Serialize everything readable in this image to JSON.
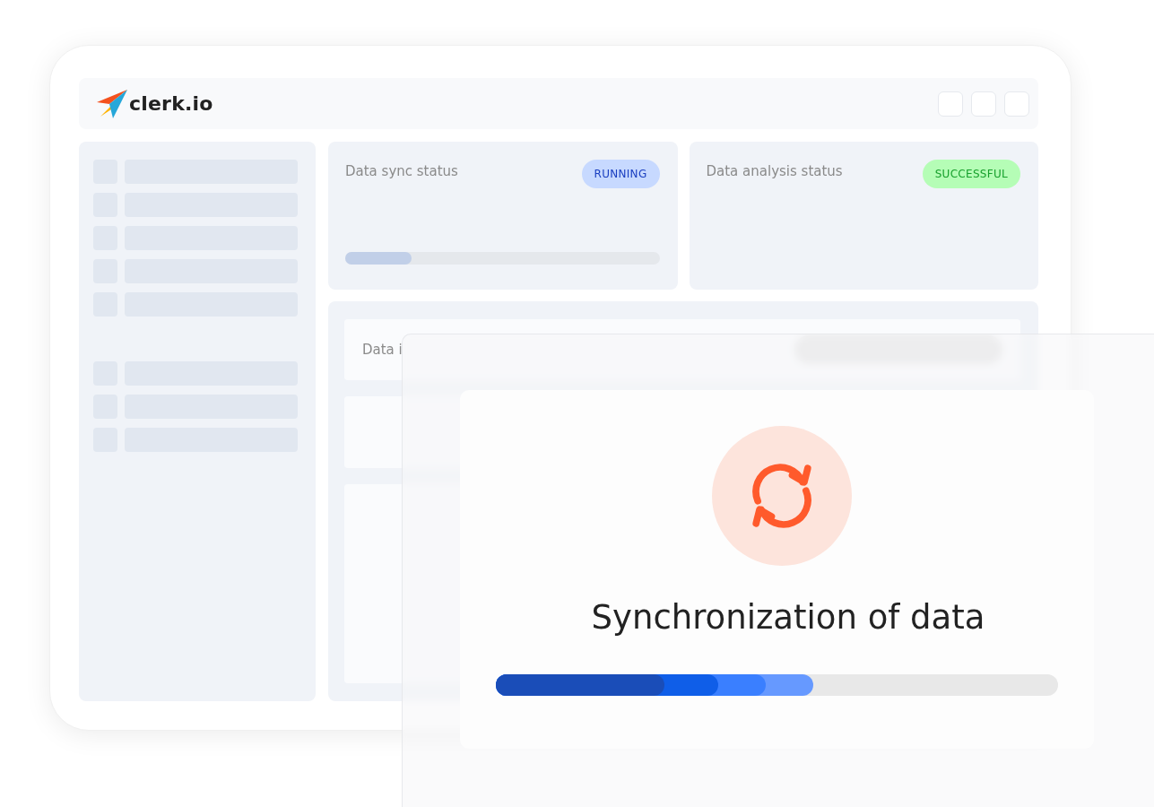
{
  "logo": {
    "text": "clerk.io"
  },
  "status_cards": [
    {
      "title": "Data sync status",
      "badge": "RUNNING",
      "kind": "progress",
      "level": 0.21,
      "color": "#c7d9ff"
    },
    {
      "title": "Data analysis status",
      "badge": "SUCCESSFUL",
      "kind": "plain",
      "color": "#b5fdb6"
    }
  ],
  "data_information": {
    "title": "Data i"
  },
  "sync_dialog": {
    "title": "Synchronization of data",
    "level": 0.565
  }
}
